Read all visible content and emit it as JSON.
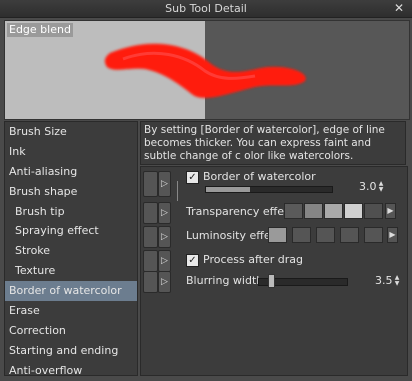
{
  "window": {
    "title": "Sub Tool Detail"
  },
  "preview": {
    "label": "Edge blend"
  },
  "categories": [
    {
      "label": "Brush Size"
    },
    {
      "label": "Ink"
    },
    {
      "label": "Anti-aliasing"
    },
    {
      "label": "Brush shape"
    },
    {
      "label": "Brush tip"
    },
    {
      "label": "Spraying effect"
    },
    {
      "label": "Stroke"
    },
    {
      "label": "Texture"
    },
    {
      "label": "Border of watercolor"
    },
    {
      "label": "Erase"
    },
    {
      "label": "Correction"
    },
    {
      "label": "Starting and ending"
    },
    {
      "label": "Anti-overflow"
    }
  ],
  "description": {
    "text": "By setting [Border of watercolor], edge of line becomes thicker. You can express faint and subtle change of c olor like watercolors."
  },
  "settings": {
    "border_of_watercolor": {
      "label": "Border of watercolor",
      "value": "3.0",
      "checked": true,
      "level": 0.3
    },
    "transparency_effect": {
      "label": "Transparency effect"
    },
    "luminosity_effect": {
      "label": "Luminosity effect"
    },
    "process_after_drag": {
      "label": "Process after drag",
      "checked": true
    },
    "blurring_width": {
      "label": "Blurring width",
      "value": "3.5",
      "level": 0.1
    }
  },
  "colors": {
    "selected_category": "#6c7d8f",
    "stroke": "#ff1a10"
  }
}
